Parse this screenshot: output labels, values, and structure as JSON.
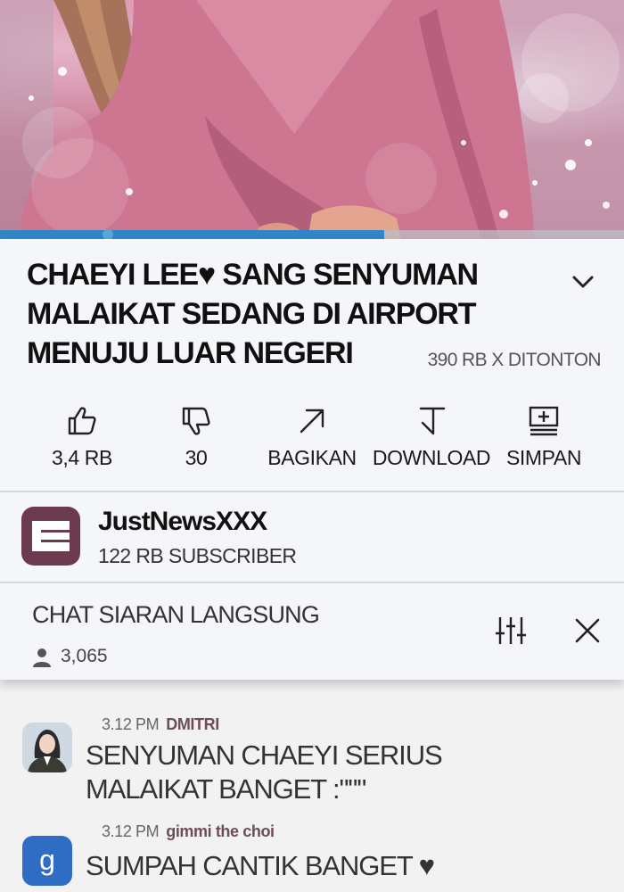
{
  "video": {
    "progress": 0.615,
    "colors": {
      "progress": "#2f86c6",
      "track": "#bebec8"
    }
  },
  "video_info": {
    "title": "CHAEYI LEE♥ SANG SENYUMAN\nMALAIKAT SEDANG DI AIRPORT\nMENUJU LUAR NEGERI",
    "views": "390 RB X DITONTON",
    "expand_icon": "chevron-down-icon"
  },
  "actions": [
    {
      "icon": "thumbs-up-icon",
      "label": "3,4 RB"
    },
    {
      "icon": "thumbs-down-icon",
      "label": "30"
    },
    {
      "icon": "share-icon",
      "label": "BAGIKAN"
    },
    {
      "icon": "download-icon",
      "label": "DOWNLOAD"
    },
    {
      "icon": "save-playlist-icon",
      "label": "SIMPAN"
    }
  ],
  "channel": {
    "name": "JustNewsXXX",
    "subscribers": "122 RB SUBSCRIBER",
    "logo_color": "#6b3a4e"
  },
  "live_chat": {
    "title": "CHAT SIARAN LANGSUNG",
    "viewer_count": "3,065",
    "filter_icon": "sliders-icon",
    "close_icon": "close-icon"
  },
  "messages": [
    {
      "time": "3.12 PM",
      "user": "DMITRI",
      "text": "SENYUMAN CHAEYI SERIUS\nMALAIKAT BANGET :\"\"\"",
      "avatar": "portrait"
    },
    {
      "time": "3.12 PM",
      "user": "gimmi the choi",
      "text": "SUMPAH CANTIK BANGET ♥",
      "avatar": "g",
      "avatar_color": "#2f6cc4"
    }
  ]
}
